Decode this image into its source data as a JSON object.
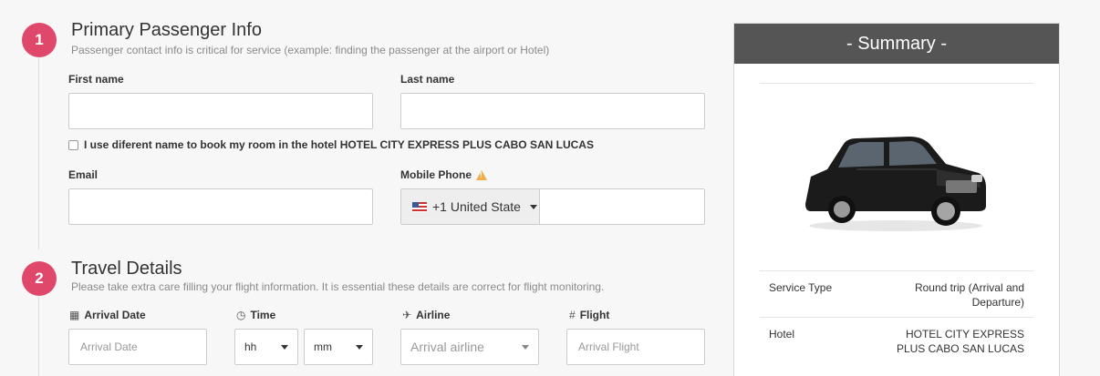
{
  "steps": [
    {
      "number": "1",
      "title": "Primary Passenger Info",
      "subtitle": "Passenger contact info is critical for service (example: finding the passenger at the airport or Hotel)"
    },
    {
      "number": "2",
      "title": "Travel Details",
      "subtitle": "Please take extra care filling your flight information. It is essential these details are correct for flight monitoring."
    }
  ],
  "passenger": {
    "first_name_label": "First name",
    "last_name_label": "Last name",
    "first_name_value": "",
    "last_name_value": "",
    "diff_name_checkbox_label": "I use diferent name to book my room in the hotel HOTEL CITY EXPRESS PLUS CABO SAN LUCAS",
    "email_label": "Email",
    "email_value": "",
    "mobile_label": "Mobile Phone",
    "country_code": "+1 United State",
    "phone_value": ""
  },
  "travel": {
    "arrival_date_label": "Arrival Date",
    "arrival_date_placeholder": "Arrival Date",
    "time_label": "Time",
    "hour_value": "hh",
    "minute_value": "mm",
    "airline_label": "Airline",
    "airline_placeholder": "Arrival airline",
    "flight_label": "Flight",
    "flight_placeholder": "Arrival Flight"
  },
  "summary": {
    "title": "- Summary -",
    "rows": [
      {
        "key": "Service Type",
        "value": "Round trip (Arrival and Departure)"
      },
      {
        "key": "Hotel",
        "value": "HOTEL CITY EXPRESS PLUS CABO SAN LUCAS"
      }
    ]
  },
  "icons": {
    "warning": "warning-triangle-icon",
    "calendar": "calendar-icon",
    "clock": "clock-icon",
    "plane": "plane-icon",
    "hash": "hash-icon"
  },
  "colors": {
    "step_accent": "#e0486b",
    "summary_header": "#555555",
    "warning": "#f0ad4e"
  }
}
